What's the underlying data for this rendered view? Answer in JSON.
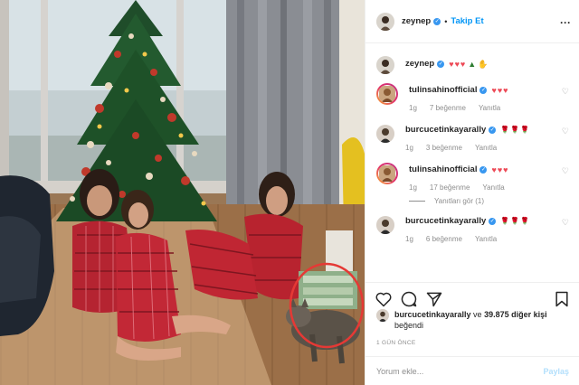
{
  "post": {
    "author": "zeynep",
    "follow_label": "Takip Et",
    "separator": "•",
    "more_label": "···",
    "caption_author": "zeynep",
    "caption_text": "♥♥♥"
  },
  "comments": [
    {
      "user": "tulinsahinofficial",
      "text": "♥♥♥",
      "time": "1g",
      "likes": "7 beğenme",
      "reply": "Yanıtla"
    },
    {
      "user": "burcucetinkayarally",
      "text": "🌹🌹🌹",
      "time": "1g",
      "likes": "3 beğenme",
      "reply": "Yanıtla"
    },
    {
      "user": "tulinsahinofficial",
      "text": "♥♥♥",
      "time": "1g",
      "likes": "17 beğenme",
      "reply": "Yanıtla",
      "view_replies": "Yanıtları gör (1)"
    },
    {
      "user": "burcucetinkayarally",
      "text": "🌹🌹🌹",
      "time": "1g",
      "likes": "6 beğenme",
      "reply": "Yanıtla"
    }
  ],
  "likes": {
    "user": "burcucetinkayarally",
    "middle": " ve ",
    "count": "39.875 diğer kişi",
    "suffix": "beğendi"
  },
  "date": "1 GÜN ÖNCE",
  "add_comment": {
    "placeholder": "Yorum ekle...",
    "share_label": "Paylaş"
  },
  "colors": {
    "link": "#0095f6",
    "verified": "#3897f0",
    "heart": "#ed4956",
    "muted": "#8e8e8e",
    "annotation_circle": "#e53935"
  },
  "icons": [
    "verified-icon",
    "heart-icon",
    "comment-icon",
    "share-icon",
    "bookmark-icon",
    "more-icon"
  ]
}
